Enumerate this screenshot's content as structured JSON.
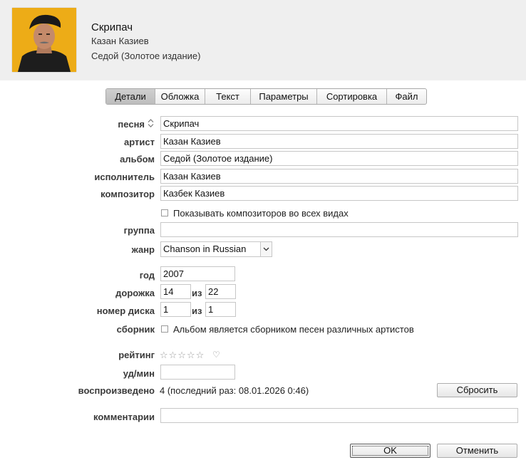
{
  "header": {
    "title": "Скрипач",
    "artist": "Казан Казиев",
    "album": "Седой (Золотое издание)",
    "artwork_icon": "album-artwork-portrait"
  },
  "tabs": [
    {
      "label": "Детали",
      "active": true
    },
    {
      "label": "Обложка",
      "active": false
    },
    {
      "label": "Текст",
      "active": false
    },
    {
      "label": "Параметры",
      "active": false
    },
    {
      "label": "Сортировка",
      "active": false
    },
    {
      "label": "Файл",
      "active": false
    }
  ],
  "labels": {
    "song": "песня",
    "artist": "артист",
    "album": "альбом",
    "album_artist": "исполнитель",
    "composer": "композитор",
    "grouping": "группа",
    "genre": "жанр",
    "year": "год",
    "track": "дорожка",
    "disc": "номер диска",
    "compilation": "сборник",
    "rating": "рейтинг",
    "bpm": "уд/мин",
    "plays": "воспроизведено",
    "comments": "комментарии",
    "of": "из"
  },
  "fields": {
    "song": "Скрипач",
    "artist": "Казан Казиев",
    "album": "Седой (Золотое издание)",
    "album_artist": "Казан Казиев",
    "composer": "Казбек Казиев",
    "grouping": "",
    "genre": "Chanson in Russian",
    "year": "2007",
    "track_number": "14",
    "track_total": "22",
    "disc_number": "1",
    "disc_total": "1",
    "bpm": "",
    "comments": ""
  },
  "checkboxes": {
    "show_composer": {
      "label": "Показывать композиторов во всех видах",
      "checked": false
    },
    "compilation": {
      "label": "Альбом является сборником песен различных артистов",
      "checked": false
    }
  },
  "rating": {
    "stars": "☆☆☆☆☆",
    "value": 0,
    "max": 5,
    "heart": "♡"
  },
  "plays": {
    "text": "4 (последний раз: 08.01.2026 0:46)"
  },
  "buttons": {
    "reset": "Сбросить",
    "ok": "OK",
    "cancel": "Отменить"
  }
}
